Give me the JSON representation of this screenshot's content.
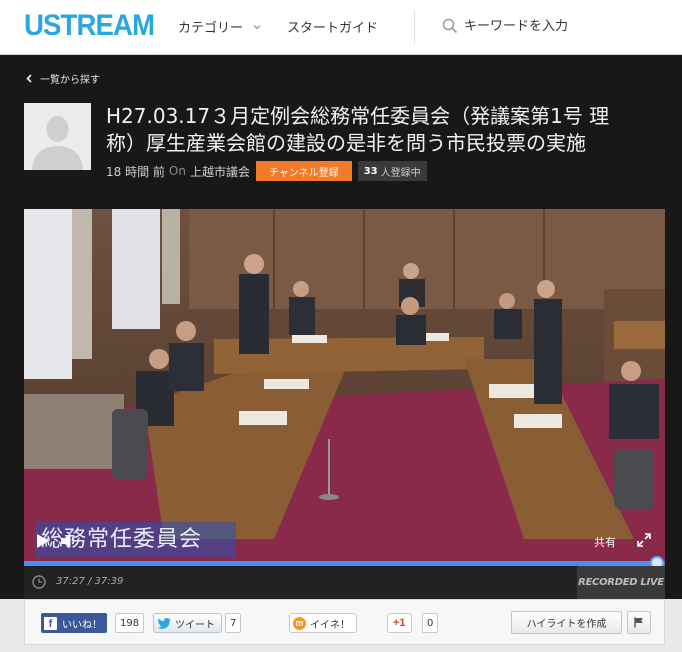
{
  "header": {
    "logo": "USTREAM",
    "category_label": "カテゴリー",
    "guide_label": "スタートガイド",
    "search_placeholder": "キーワードを入力"
  },
  "page": {
    "back_label": "一覧から探す",
    "title": "H27.03.17３月定例会総務常任委員会（発議案第1号 理\n称）厚生産業会館の建設の是非を問う市民投票の実施",
    "meta": {
      "time_ago": "18 時間 前",
      "on_label": "On",
      "channel": "上越市議会",
      "subscribe_label": "チャンネル登録",
      "subscriber_count": "33",
      "subscriber_suffix": "人登録中"
    }
  },
  "player": {
    "caption": "総務常任委員会",
    "share_label": "共有",
    "progress_fraction": 0.9879,
    "current_time": "37:27",
    "duration": "37:39",
    "time_display": "37:27 / 37:39",
    "recorded_label": "RECORDED LIVE"
  },
  "social": {
    "fb_label": "いいね！",
    "fb_count": "198",
    "tweet_label": "ツイート",
    "tweet_count": "7",
    "mixi_label": "イイネ！",
    "gplus_label": "+1",
    "gplus_count": "0",
    "highlight_label": "ハイライトを作成"
  },
  "colors": {
    "brand": "#2aa6e0",
    "subscribe": "#f17b2a",
    "progress": "#4d8ef0",
    "facebook": "#3b5998"
  }
}
